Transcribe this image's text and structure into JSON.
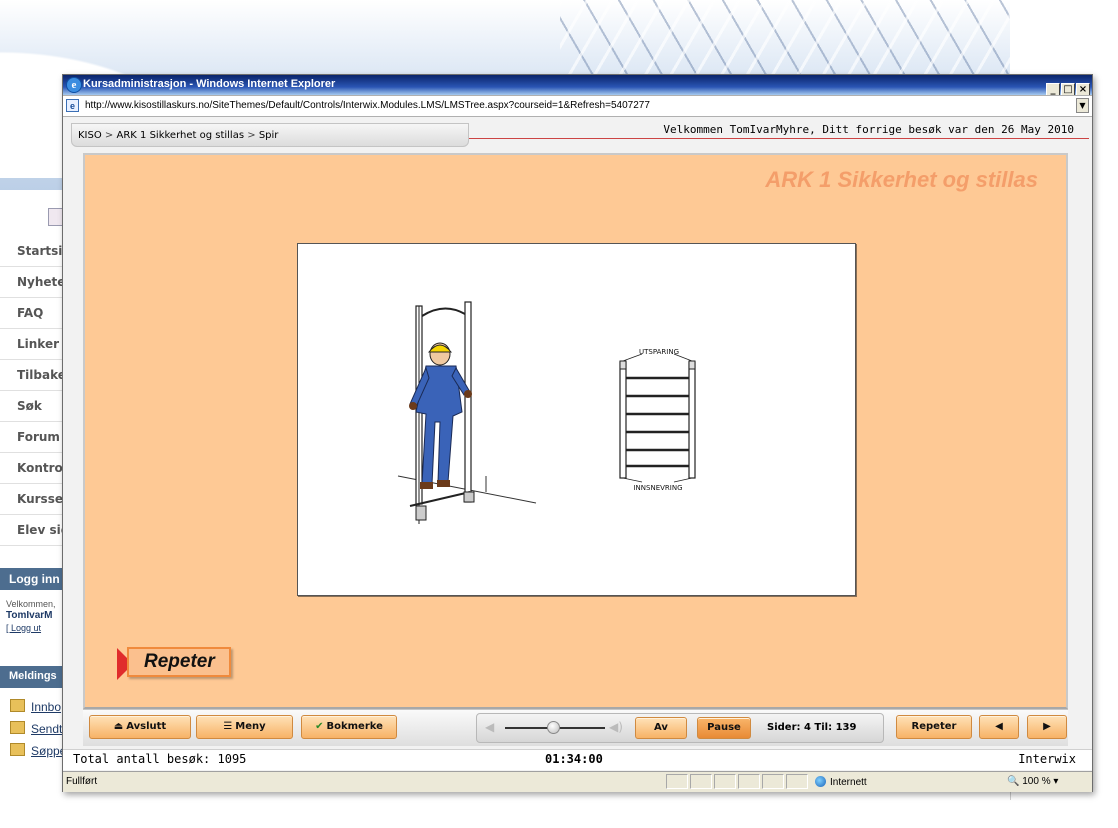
{
  "background": {
    "nav_items": [
      "Startsid",
      "Nyheter",
      "FAQ",
      "Linker",
      "Tilbaker",
      "Søk",
      "Forum",
      "Kontrol",
      "Kursser",
      "Elev sid"
    ],
    "login_header": "Logg inn",
    "welcome_prefix": "Velkommen,",
    "user_partial": "TomIvarM",
    "logout_link": "[ Logg ut",
    "messages_header": "Meldings",
    "message_links": [
      "Innbo",
      "Sendt",
      "Søppe"
    ]
  },
  "window": {
    "title": "Kursadministrasjon - Windows Internet Explorer",
    "url": "http://www.kisostillaskurs.no/SiteThemes/Default/Controls/Interwix.Modules.LMS/LMSTree.aspx?courseid=1&Refresh=5407277",
    "buttons": {
      "minimize": "_",
      "maximize": "□",
      "close": "×"
    }
  },
  "breadcrumb": [
    "KISO",
    "ARK 1 Sikkerhet og stillas",
    "Spir"
  ],
  "breadcrumb_separator": ">",
  "welcome_message": "Velkommen TomIvarMyhre, Ditt forrige besøk var den 26 May 2010",
  "stage": {
    "title": "ARK 1 Sikkerhet og stillas",
    "diagram_labels": {
      "top": "UTSPARING",
      "bottom": "INNSNEVRING"
    },
    "repeter_button": "Repeter"
  },
  "controls": {
    "exit": "Avslutt",
    "menu": "Meny",
    "bookmark": "Bokmerke",
    "sound_off": "Av",
    "pause": "Pause",
    "pages": "Sider: 4 Til: 139",
    "repeat": "Repeter",
    "prev_icon": "left-arrow-icon",
    "next_icon": "right-arrow-icon",
    "volume_level": 0.5
  },
  "statusbar": {
    "total_visits": "Total antall besøk: 1095",
    "timer": "01:34:00",
    "brand": "Interwix"
  },
  "ie_status": {
    "state": "Fullført",
    "zone": "Internett",
    "zoom": "100 %"
  },
  "colors": {
    "stage_bg": "#fec995",
    "title_color": "#f49e6a",
    "button_orange": "#f7b266",
    "arrow_red": "#e02c2c"
  }
}
